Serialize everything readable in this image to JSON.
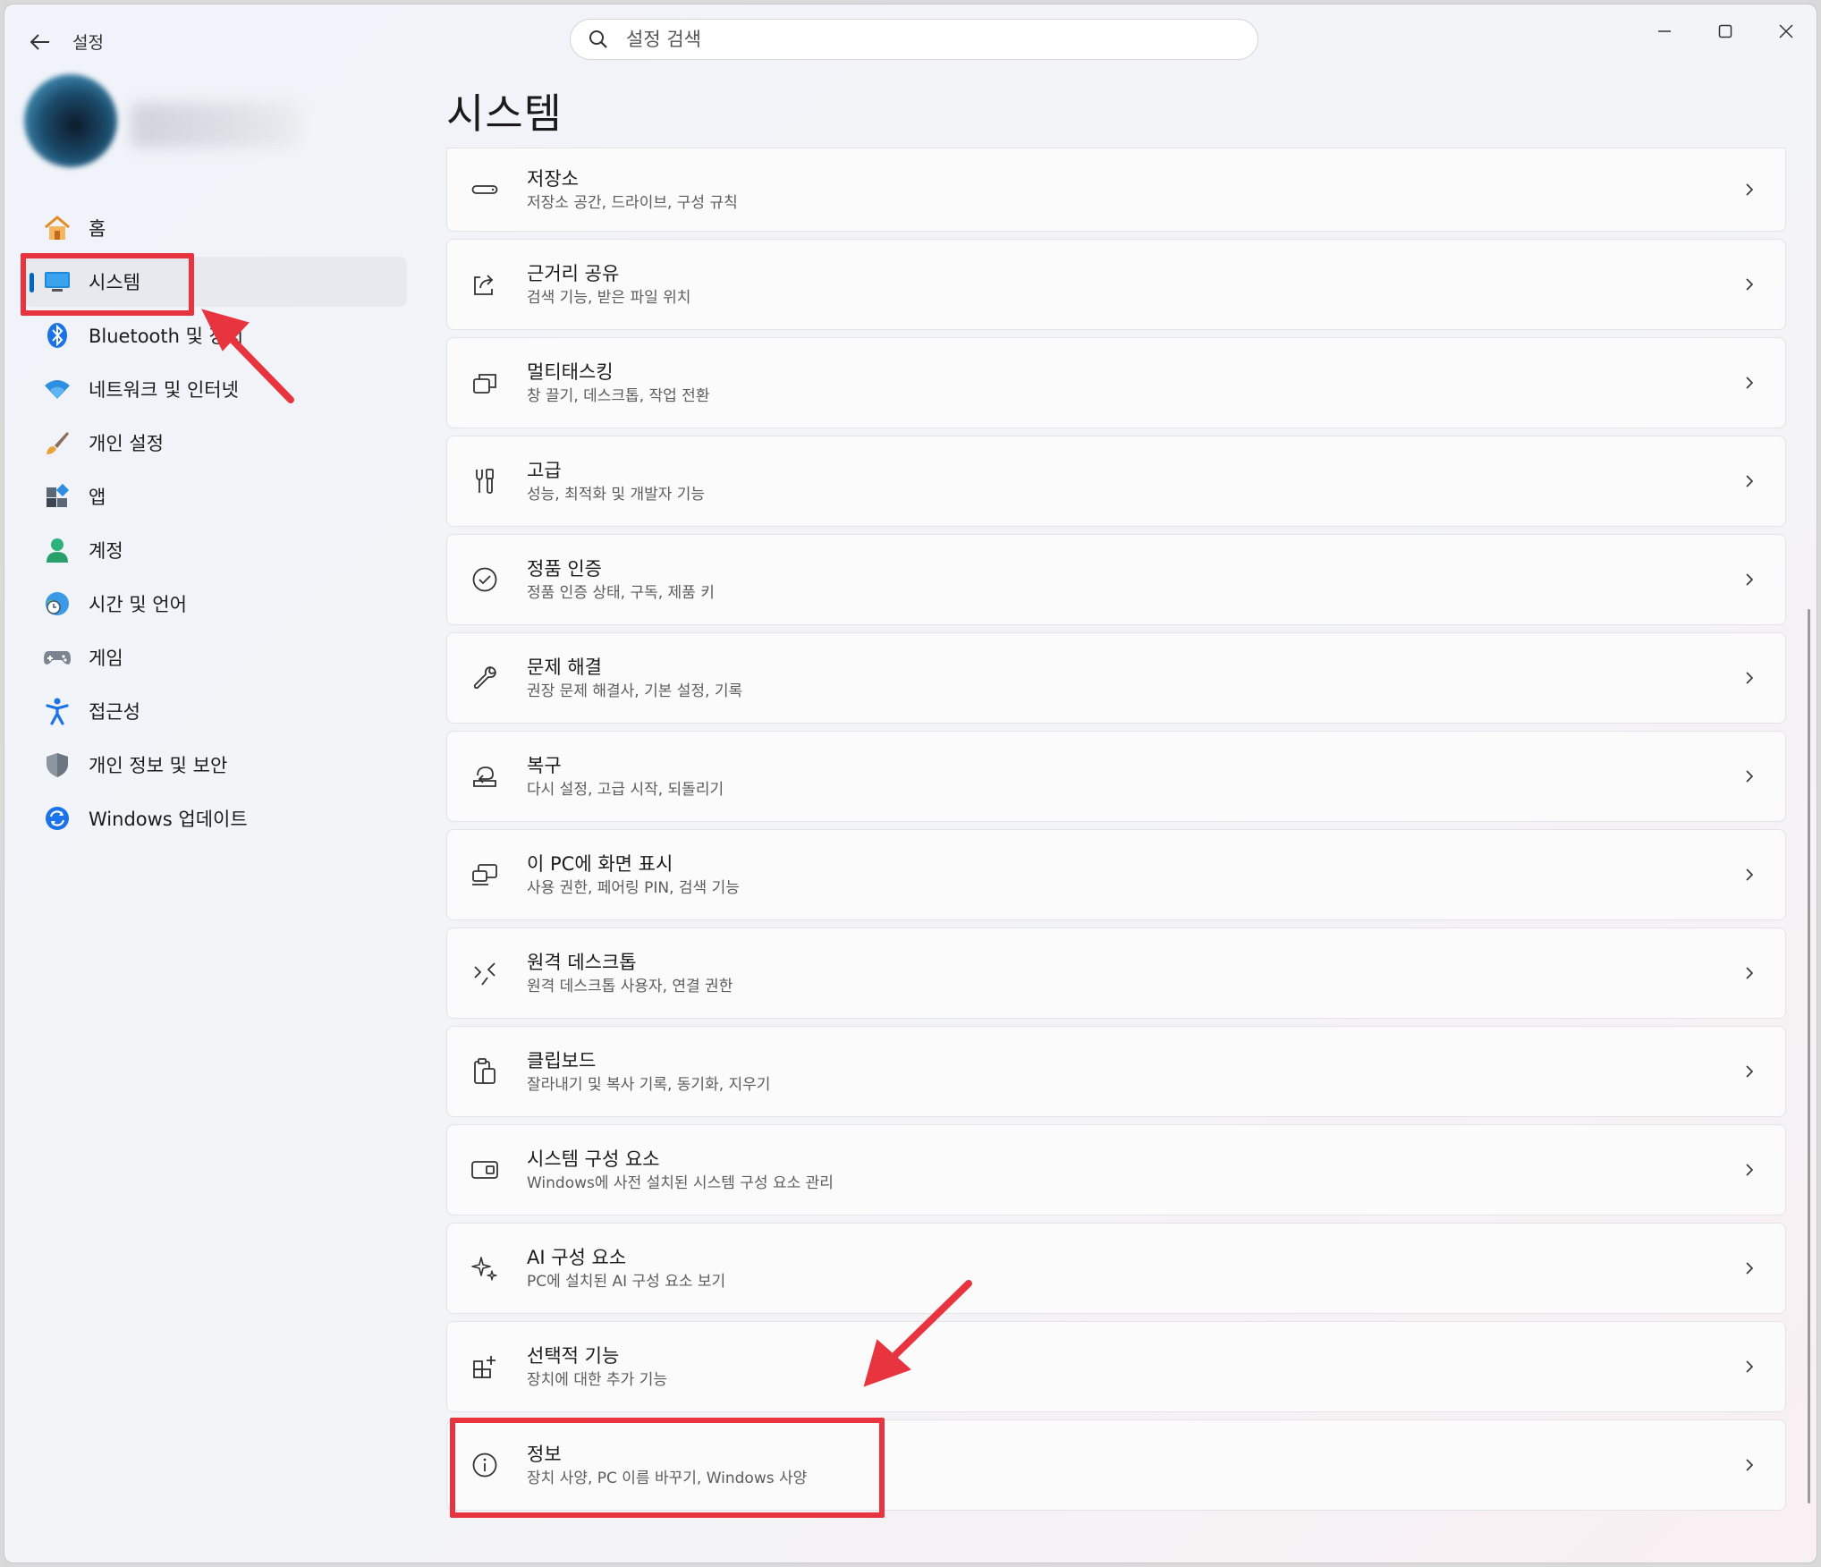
{
  "window": {
    "title": "설정"
  },
  "search": {
    "placeholder": "설정 검색"
  },
  "sidebar": {
    "items": [
      {
        "label": "홈",
        "icon": "home-icon",
        "active": false
      },
      {
        "label": "시스템",
        "icon": "system-monitor-icon",
        "active": true
      },
      {
        "label": "Bluetooth 및 장치",
        "icon": "bluetooth-icon",
        "active": false
      },
      {
        "label": "네트워크 및 인터넷",
        "icon": "wifi-icon",
        "active": false
      },
      {
        "label": "개인 설정",
        "icon": "paintbrush-icon",
        "active": false
      },
      {
        "label": "앱",
        "icon": "apps-icon",
        "active": false
      },
      {
        "label": "계정",
        "icon": "account-icon",
        "active": false
      },
      {
        "label": "시간 및 언어",
        "icon": "globe-clock-icon",
        "active": false
      },
      {
        "label": "게임",
        "icon": "gamepad-icon",
        "active": false
      },
      {
        "label": "접근성",
        "icon": "accessibility-icon",
        "active": false
      },
      {
        "label": "개인 정보 및 보안",
        "icon": "shield-icon",
        "active": false
      },
      {
        "label": "Windows 업데이트",
        "icon": "update-icon",
        "active": false
      }
    ]
  },
  "main": {
    "title": "시스템",
    "items": [
      {
        "title": "저장소",
        "subtitle": "저장소 공간, 드라이브, 구성 규칙",
        "icon": "storage-icon"
      },
      {
        "title": "근거리 공유",
        "subtitle": "검색 기능, 받은 파일 위치",
        "icon": "share-icon"
      },
      {
        "title": "멀티태스킹",
        "subtitle": "창 끌기, 데스크톱, 작업 전환",
        "icon": "multitasking-icon"
      },
      {
        "title": "고급",
        "subtitle": "성능, 최적화 및 개발자 기능",
        "icon": "tools-icon"
      },
      {
        "title": "정품 인증",
        "subtitle": "정품 인증 상태, 구독, 제품 키",
        "icon": "check-circle-icon"
      },
      {
        "title": "문제 해결",
        "subtitle": "권장 문제 해결사, 기본 설정, 기록",
        "icon": "wrench-icon"
      },
      {
        "title": "복구",
        "subtitle": "다시 설정, 고급 시작, 되돌리기",
        "icon": "recovery-icon"
      },
      {
        "title": "이 PC에 화면 표시",
        "subtitle": "사용 권한, 페어링 PIN, 검색 기능",
        "icon": "project-icon"
      },
      {
        "title": "원격 데스크톱",
        "subtitle": "원격 데스크톱 사용자, 연결 권한",
        "icon": "remote-desktop-icon"
      },
      {
        "title": "클립보드",
        "subtitle": "잘라내기 및 복사 기록, 동기화, 지우기",
        "icon": "clipboard-icon"
      },
      {
        "title": "시스템 구성 요소",
        "subtitle": "Windows에 사전 설치된 시스템 구성 요소 관리",
        "icon": "system-components-icon"
      },
      {
        "title": "AI 구성 요소",
        "subtitle": "PC에 설치된 AI 구성 요소 보기",
        "icon": "sparkle-icon"
      },
      {
        "title": "선택적 기능",
        "subtitle": "장치에 대한 추가 기능",
        "icon": "optional-features-icon"
      },
      {
        "title": "정보",
        "subtitle": "장치 사양, PC 이름 바꾸기, Windows 사양",
        "icon": "info-icon"
      }
    ]
  },
  "colors": {
    "accent": "#0067c0",
    "annotation": "#e8343f"
  }
}
